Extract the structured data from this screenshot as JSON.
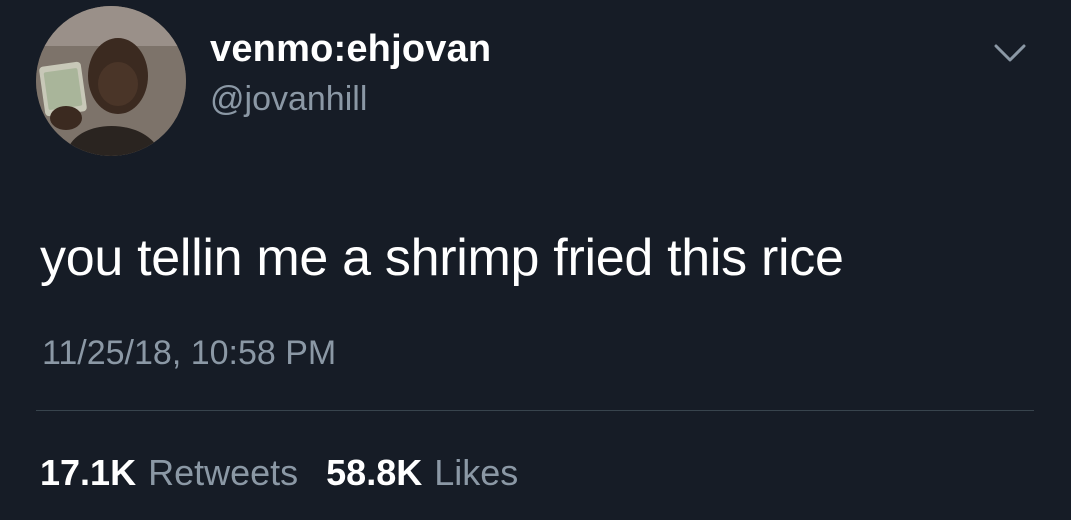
{
  "user": {
    "display_name": "venmo:ehjovan",
    "handle": "@jovanhill"
  },
  "tweet": {
    "text": "you tellin me a shrimp fried this rice",
    "timestamp": "11/25/18, 10:58 PM"
  },
  "stats": {
    "retweets_count": "17.1K",
    "retweets_label": "Retweets",
    "likes_count": "58.8K",
    "likes_label": "Likes"
  },
  "icons": {
    "menu": "chevron-down-icon"
  },
  "colors": {
    "background": "#161c26",
    "primary_text": "#ffffff",
    "secondary_text": "#8b98a5",
    "divider": "#38444d"
  }
}
